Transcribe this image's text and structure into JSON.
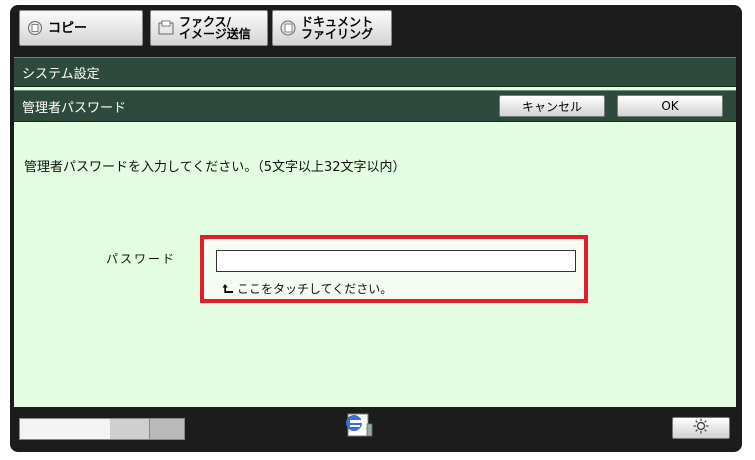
{
  "tabs": [
    {
      "label": "コピー",
      "icon": "copy-icon"
    },
    {
      "label": "ファクス/\nイメージ送信",
      "icon": "fax-icon"
    },
    {
      "label": "ドキュメント\nファイリング",
      "icon": "document-filing-icon"
    }
  ],
  "header": {
    "title": "システム設定",
    "subtitle": "管理者パスワード",
    "cancel_label": "キャンセル",
    "ok_label": "OK"
  },
  "main": {
    "instruction": "管理者パスワードを入力してください。（5文字以上32文字以内）",
    "password_label": "パスワード",
    "password_value": "",
    "hint": "ここをタッチしてください。"
  },
  "footer": {
    "progress_fraction": 0.55,
    "job_status_icon": "job-status-icon",
    "brightness_icon": "brightness-icon"
  },
  "colors": {
    "screen_background": "#e3fde0",
    "titlebar": "#2e4a3c",
    "highlight": "#e11f2c",
    "frame": "#1c1c1c"
  }
}
